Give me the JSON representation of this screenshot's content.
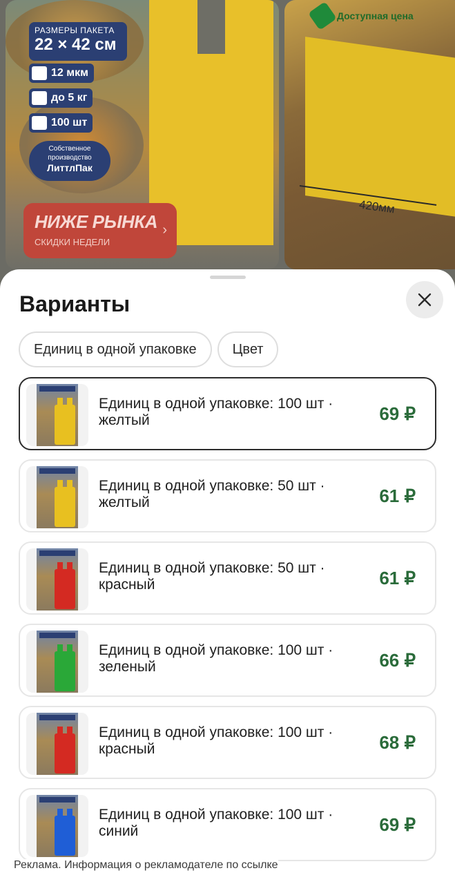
{
  "banner": {
    "size_label": "РАЗМЕРЫ ПАКЕТА",
    "size_value": "22 × 42 см",
    "specs": [
      "12 мкм",
      "до 5 кг",
      "100 шт"
    ],
    "own_production_line1": "Собственное производство",
    "own_production_brand": "ЛиттлПак",
    "promo_title": "НИЖЕ РЫНКА",
    "promo_sub": "СКИДКИ НЕДЕЛИ",
    "promo_chevron": "›",
    "price_tag": "Доступная цена",
    "dimension": "420мм"
  },
  "sheet": {
    "title": "Варианты",
    "close_icon": "close-icon",
    "chips": [
      "Единиц в одной упаковке",
      "Цвет"
    ]
  },
  "variants": [
    {
      "title": "Единиц в одной упаковке: 100 шт · желтый",
      "price": "69 ₽",
      "color": "#e8c020",
      "selected": true
    },
    {
      "title": "Единиц в одной упаковке: 50 шт · желтый",
      "price": "61 ₽",
      "color": "#e8c020",
      "selected": false
    },
    {
      "title": "Единиц в одной упаковке: 50 шт · красный",
      "price": "61 ₽",
      "color": "#d42a22",
      "selected": false
    },
    {
      "title": "Единиц в одной упаковке: 100 шт · зеленый",
      "price": "66 ₽",
      "color": "#2aa838",
      "selected": false
    },
    {
      "title": "Единиц в одной упаковке: 100 шт · красный",
      "price": "68 ₽",
      "color": "#d42a22",
      "selected": false
    },
    {
      "title": "Единиц в одной упаковке: 100 шт · синий",
      "price": "69 ₽",
      "color": "#1f5ed6",
      "selected": false
    }
  ],
  "footer": {
    "ad_note": "Реклама. Информация о рекламодателе по ссылке"
  }
}
